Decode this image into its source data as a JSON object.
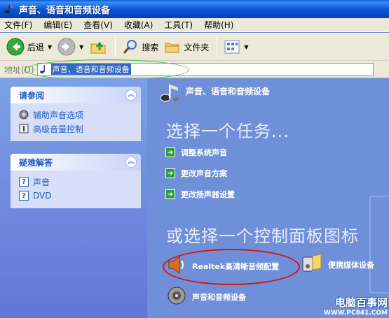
{
  "window": {
    "title": "声音、语音和音频设备"
  },
  "menu": [
    {
      "label": "文件(F)"
    },
    {
      "label": "编辑(E)"
    },
    {
      "label": "查看(V)"
    },
    {
      "label": "收藏(A)"
    },
    {
      "label": "工具(T)"
    },
    {
      "label": "帮助(H)"
    }
  ],
  "toolbar": {
    "back_label": "后退",
    "search_label": "搜索",
    "folders_label": "文件夹"
  },
  "address": {
    "label": "地址(D)",
    "value": "声音、语音和音频设备"
  },
  "see_also": {
    "title": "请参阅",
    "items": [
      {
        "label": "辅助声音选项"
      },
      {
        "label": "高级音量控制"
      }
    ]
  },
  "troubleshoot": {
    "title": "疑难解答",
    "items": [
      {
        "label": "声音"
      },
      {
        "label": "DVD"
      }
    ]
  },
  "main": {
    "header_title": "声音、语音和音频设备",
    "pick_task": "选择一个任务...",
    "tasks": [
      {
        "label": "调整系统声音"
      },
      {
        "label": "更改声音方案"
      },
      {
        "label": "更改扬声器设置"
      }
    ],
    "pick_icon": "或选择一个控制面板图标",
    "icons": [
      {
        "label": "Realtek高清晰音频配置"
      },
      {
        "label": "便携媒体设备"
      },
      {
        "label": "声音和音频设备"
      }
    ]
  },
  "watermark": {
    "title": "电脑百事网",
    "url": "WWW.PC841.COM"
  },
  "colors": {
    "titlebar": "#0b57d6",
    "pane": "#6f8fd8",
    "highlight_red": "#d81414",
    "highlight_green": "#3cc04a"
  }
}
